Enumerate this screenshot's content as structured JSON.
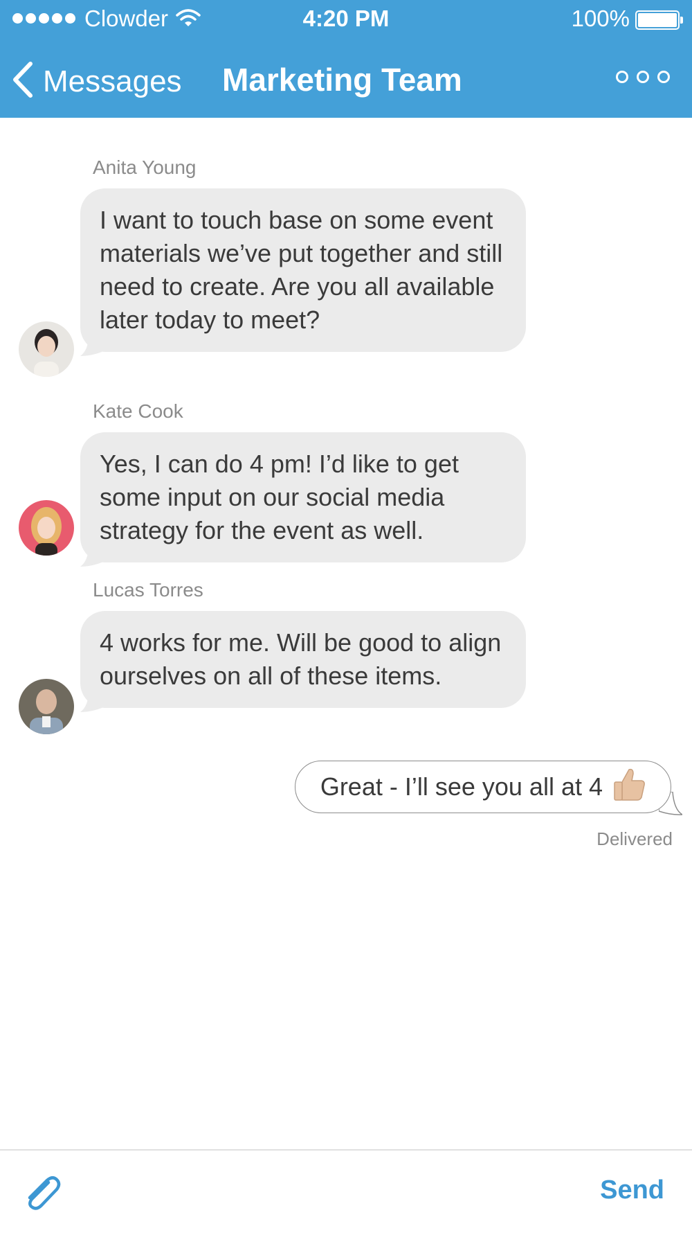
{
  "status_bar": {
    "carrier": "Clowder",
    "time": "4:20 PM",
    "battery": "100%"
  },
  "nav": {
    "back_label": "Messages",
    "title": "Marketing Team"
  },
  "messages": [
    {
      "sender": "Anita Young",
      "text": "I want to touch base on some event materials we’ve put together and still need to create. Are you all available later today to meet?"
    },
    {
      "sender": "Kate Cook",
      "text": "Yes, I can do 4 pm! I’d like to get some input on our social media strategy for the event as well."
    },
    {
      "sender": "Lucas Torres",
      "text": "4 works for me. Will be good to align ourselves on all of these items."
    }
  ],
  "outgoing": {
    "text": "Great - I’ll see you all at 4",
    "status": "Delivered"
  },
  "composer": {
    "send_label": "Send"
  },
  "colors": {
    "header": "#44a0d8",
    "incoming_bubble": "#ebebeb",
    "send": "#3d97d3"
  }
}
